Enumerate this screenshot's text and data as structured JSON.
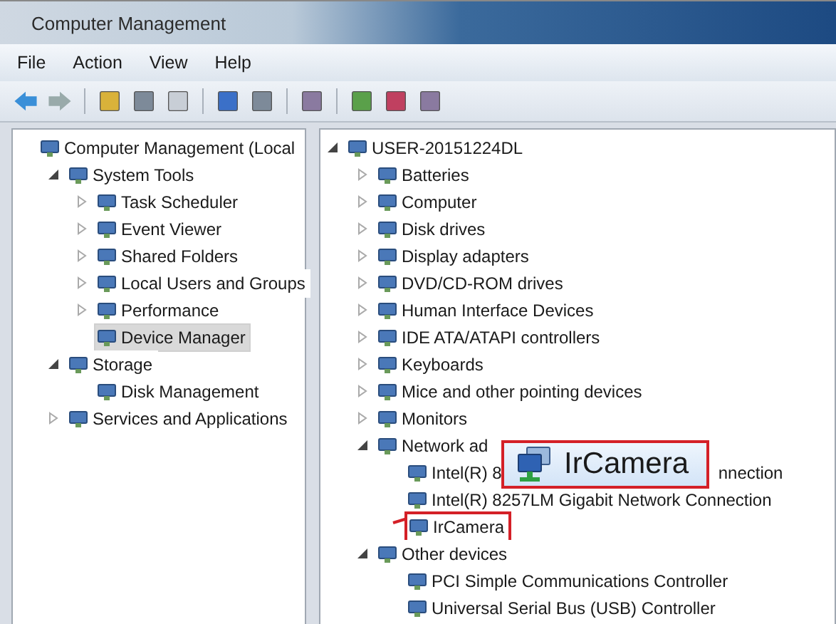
{
  "window": {
    "title": "Computer Management"
  },
  "menu": [
    "File",
    "Action",
    "View",
    "Help"
  ],
  "left_tree": [
    {
      "label": "Computer Management (Local",
      "selected": false,
      "children": [
        {
          "label": "System Tools",
          "expanded": true,
          "selected": false,
          "children": [
            {
              "label": "Task Scheduler",
              "expanded": false,
              "selected": false
            },
            {
              "label": "Event Viewer",
              "expanded": false,
              "selected": false
            },
            {
              "label": "Shared Folders",
              "expanded": false,
              "selected": false
            },
            {
              "label": "Local Users and Groups",
              "expanded": false,
              "selected": false
            },
            {
              "label": "Performance",
              "expanded": false,
              "selected": false
            },
            {
              "label": "Device Manager",
              "selected": true
            }
          ]
        },
        {
          "label": "Storage",
          "expanded": true,
          "selected": false,
          "children": [
            {
              "label": "Disk Management",
              "selected": false
            }
          ]
        },
        {
          "label": "Services and Applications",
          "expanded": false,
          "selected": false
        }
      ]
    }
  ],
  "right_tree": [
    {
      "label": "USER-20151224DL",
      "expanded": true,
      "highlighted": false,
      "children": [
        {
          "label": "Batteries",
          "expanded": false,
          "highlighted": false
        },
        {
          "label": "Computer",
          "expanded": false,
          "highlighted": false
        },
        {
          "label": "Disk drives",
          "expanded": false,
          "highlighted": false
        },
        {
          "label": "Display adapters",
          "expanded": false,
          "highlighted": false
        },
        {
          "label": "DVD/CD-ROM drives",
          "expanded": false,
          "highlighted": false
        },
        {
          "label": "Human Interface Devices",
          "expanded": false,
          "highlighted": false
        },
        {
          "label": "IDE ATA/ATAPI controllers",
          "expanded": false,
          "highlighted": false
        },
        {
          "label": "Keyboards",
          "expanded": false,
          "highlighted": false
        },
        {
          "label": "Mice and other pointing devices",
          "expanded": false,
          "highlighted": false
        },
        {
          "label": "Monitors",
          "expanded": false,
          "highlighted": false
        },
        {
          "label": "Network ad",
          "expanded": true,
          "highlighted": false,
          "children": [
            {
              "label": "Intel(R) 8",
              "tail": "nnection",
              "highlighted": false
            },
            {
              "label": "Intel(R) 8257LM Gigabit Network Connection",
              "highlighted": false
            },
            {
              "label": "IrCamera",
              "highlighted": true
            }
          ]
        },
        {
          "label": "Other devices",
          "expanded": true,
          "highlighted": false,
          "children": [
            {
              "label": "PCI Simple Communications Controller",
              "highlighted": false
            },
            {
              "label": "Universal Serial Bus (USB) Controller",
              "highlighted": false
            }
          ]
        }
      ]
    }
  ],
  "callout": {
    "label": "IrCamera"
  }
}
